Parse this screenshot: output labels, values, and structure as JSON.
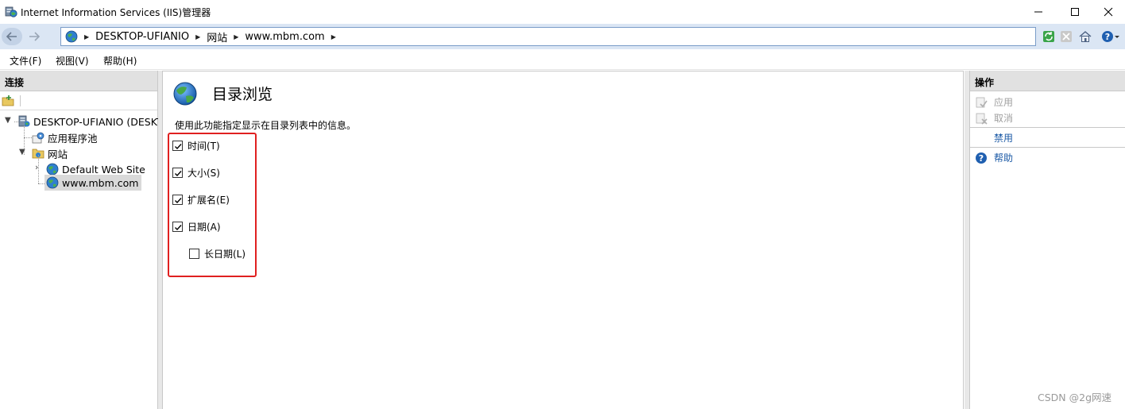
{
  "window": {
    "title": "Internet Information Services (IIS)管理器",
    "controls": {
      "minimize": "—",
      "maximize": "☐",
      "close": "✕"
    }
  },
  "address": {
    "crumbs": [
      "DESKTOP-UFIANIO",
      "网站",
      "www.mbm.com"
    ]
  },
  "menu": {
    "items": [
      "文件(F)",
      "视图(V)",
      "帮助(H)"
    ]
  },
  "connections": {
    "header": "连接",
    "tree": {
      "server": "DESKTOP-UFIANIO (DESKT",
      "app_pools": "应用程序池",
      "sites": "网站",
      "default_site": "Default Web Site",
      "selected_site": "www.mbm.com"
    }
  },
  "feature": {
    "title": "目录浏览",
    "description": "使用此功能指定显示在目录列表中的信息。",
    "options": [
      {
        "label": "时间(T)",
        "checked": true
      },
      {
        "label": "大小(S)",
        "checked": true
      },
      {
        "label": "扩展名(E)",
        "checked": true
      },
      {
        "label": "日期(A)",
        "checked": true
      },
      {
        "label": "长日期(L)",
        "checked": false
      }
    ]
  },
  "actions": {
    "header": "操作",
    "apply": "应用",
    "cancel": "取消",
    "disable": "禁用",
    "help": "帮助"
  },
  "watermark": "CSDN @2g网速",
  "colors": {
    "link": "#1c5aa6",
    "highlight_box": "#e02020",
    "header_bg": "#e1e1e1"
  }
}
